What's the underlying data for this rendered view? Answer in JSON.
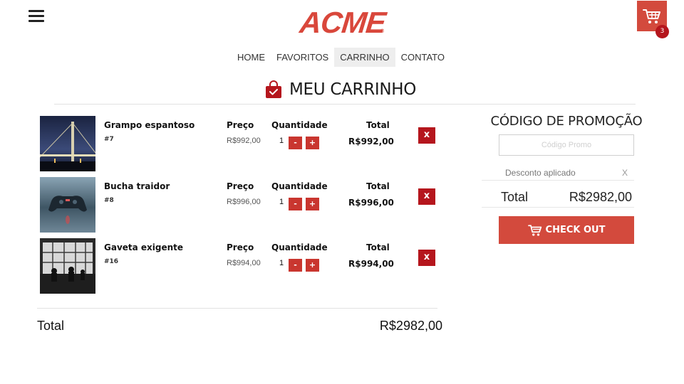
{
  "header": {
    "logo_text": "ACME",
    "logo_mark": "®",
    "cart_count": "3",
    "brand_color": "#d34a3d",
    "badge_color": "#b5161d"
  },
  "nav": {
    "items": [
      {
        "label": "HOME",
        "active": false
      },
      {
        "label": "FAVORITOS",
        "active": false
      },
      {
        "label": "CARRINHO",
        "active": true
      },
      {
        "label": "CONTATO",
        "active": false
      }
    ]
  },
  "page_title": "MEU CARRINHO",
  "columns": {
    "price": "Preço",
    "quantity": "Quantidade",
    "total": "Total"
  },
  "cart_items": [
    {
      "name": "Grampo espantoso",
      "id": "#7",
      "price": "R$992,00",
      "qty": "1",
      "total": "R$992,00",
      "image": "bridge at night"
    },
    {
      "name": "Bucha traidor",
      "id": "#8",
      "price": "R$996,00",
      "qty": "1",
      "total": "R$996,00",
      "image": "game controller"
    },
    {
      "name": "Gaveta exigente",
      "id": "#16",
      "price": "R$994,00",
      "qty": "1",
      "total": "R$994,00",
      "image": "airport window silhouettes"
    }
  ],
  "buttons": {
    "minus": "-",
    "plus": "+",
    "remove": "x"
  },
  "summary": {
    "total_label": "Total",
    "total_value": "R$2982,00"
  },
  "promo": {
    "title": "CÓDIGO DE PROMOÇÃO",
    "placeholder": "Código Promo",
    "discount_label": "Desconto aplicado",
    "discount_clear": "X",
    "total_label": "Total",
    "total_value": "R$2982,00",
    "checkout_label": "CHECK OUT"
  }
}
